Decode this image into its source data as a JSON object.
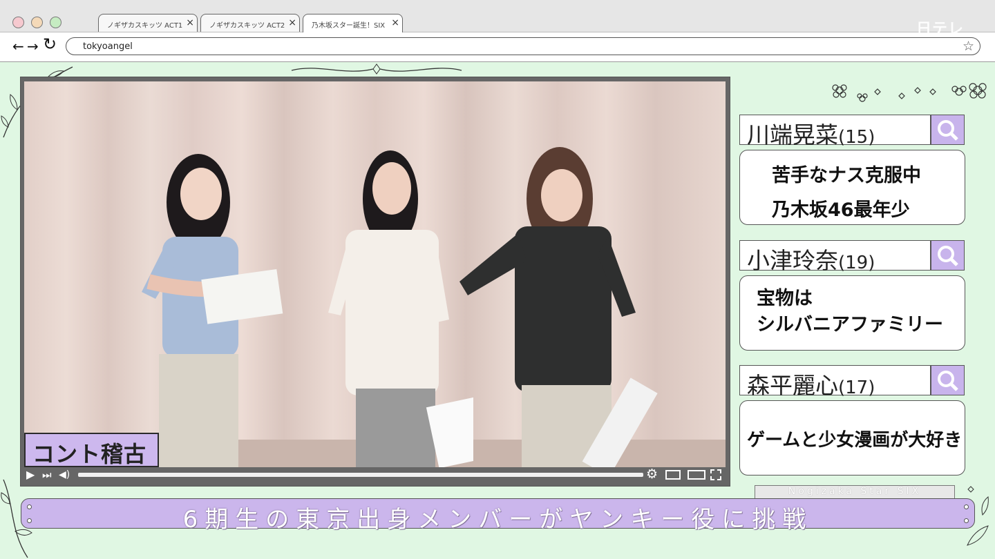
{
  "browser": {
    "tabs": [
      {
        "label": "ノギザカスキッツ ACT1",
        "close": "×"
      },
      {
        "label": "ノギザカスキッツ ACT2",
        "close": "×"
      },
      {
        "label": "乃木坂スター誕生！SIX",
        "close": "×"
      }
    ],
    "nav": {
      "back": "←",
      "forward": "→",
      "reload": "↻"
    },
    "url": "tokyoangel",
    "bookmark_icon": "star-icon",
    "watermark": "日テレ"
  },
  "video": {
    "caption": "コント稽古",
    "controls": {
      "play": "▶",
      "next": "⏭",
      "volume": "🔊",
      "settings": "⚙",
      "miniplayer": "▭",
      "theater": "▭",
      "fullscreen": "⛶"
    },
    "progress": 0.0
  },
  "members": [
    {
      "name": "川端晃菜",
      "age": "(15)",
      "desc_lines": [
        "苦手なナス克服中",
        "乃木坂46最年少"
      ]
    },
    {
      "name": "小津玲奈",
      "age": "(19)",
      "desc_lines": [
        "宝物は",
        "シルバニアファミリー"
      ]
    },
    {
      "name": "森平麗心",
      "age": "(17)",
      "desc_lines": [
        "ゲームと少女漫画が大好き"
      ]
    }
  ],
  "subtitle": "6期生の東京出身メンバーがヤンキー役に挑戦",
  "show_logo": "Nogizaka Star SIX",
  "colors": {
    "background": "#e0f7e3",
    "accent_purple": "#cbb6ec",
    "border": "#555555"
  }
}
